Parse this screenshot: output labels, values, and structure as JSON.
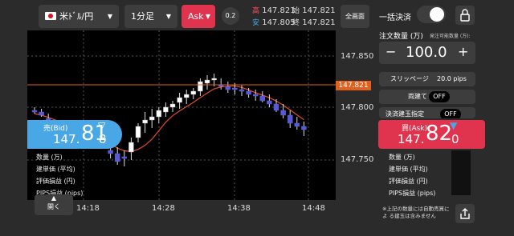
{
  "toolbar": {
    "pair": "米ﾄﾞﾙ/円",
    "timeframe": "1分足",
    "side": "Ask",
    "spread": "0.2",
    "high_label": "高",
    "high_value": "147.821",
    "open_label": "始",
    "open_value": "147.821",
    "low_label": "安",
    "low_value": "147.805",
    "close_label": "終",
    "close_value": "147.821",
    "fullscreen_label": "全画面"
  },
  "chart": {
    "price_labels": [
      "147.850",
      "147.800",
      "147.750"
    ],
    "current_price": "147.821",
    "time_labels": [
      "14:18",
      "14:28",
      "14:38",
      "14:48"
    ],
    "colors": {
      "up": "#ffffff",
      "down": "#5a5ad6",
      "ma": "#e0502a",
      "current_line": "#e06020"
    }
  },
  "bid": {
    "label": "売(Bid)",
    "prefix": "147.",
    "big": "81",
    "small": "8",
    "arrow": "▽"
  },
  "ask": {
    "label": "買(Ask)",
    "prefix": "147.",
    "big": "82",
    "small": "0",
    "arrow": "▼"
  },
  "left_info": [
    "数量 (万)",
    "建単価 (平均)",
    "評価損益 (円)",
    "PIPS損益 (pips)"
  ],
  "right_info": [
    "数量 (万)",
    "建単価 (平均)",
    "評価損益 (円)",
    "PIPS損益 (pips)"
  ],
  "open_button_label": "開く",
  "panel": {
    "bulk_settle_label": "一括決済",
    "order_qty_label": "注文数量 (万)",
    "available_label": "発注可能数量 (万):",
    "qty_value": "100.0",
    "minus": "−",
    "plus": "+",
    "slippage_label": "スリッページ",
    "slippage_value": "20.0 pips",
    "both_label": "両建て",
    "both_value": "OFF",
    "settle_order_label": "決済建玉指定",
    "settle_order_value": "OFF",
    "note": "※上記の数量には自動売買によ る建玉は含みません"
  }
}
